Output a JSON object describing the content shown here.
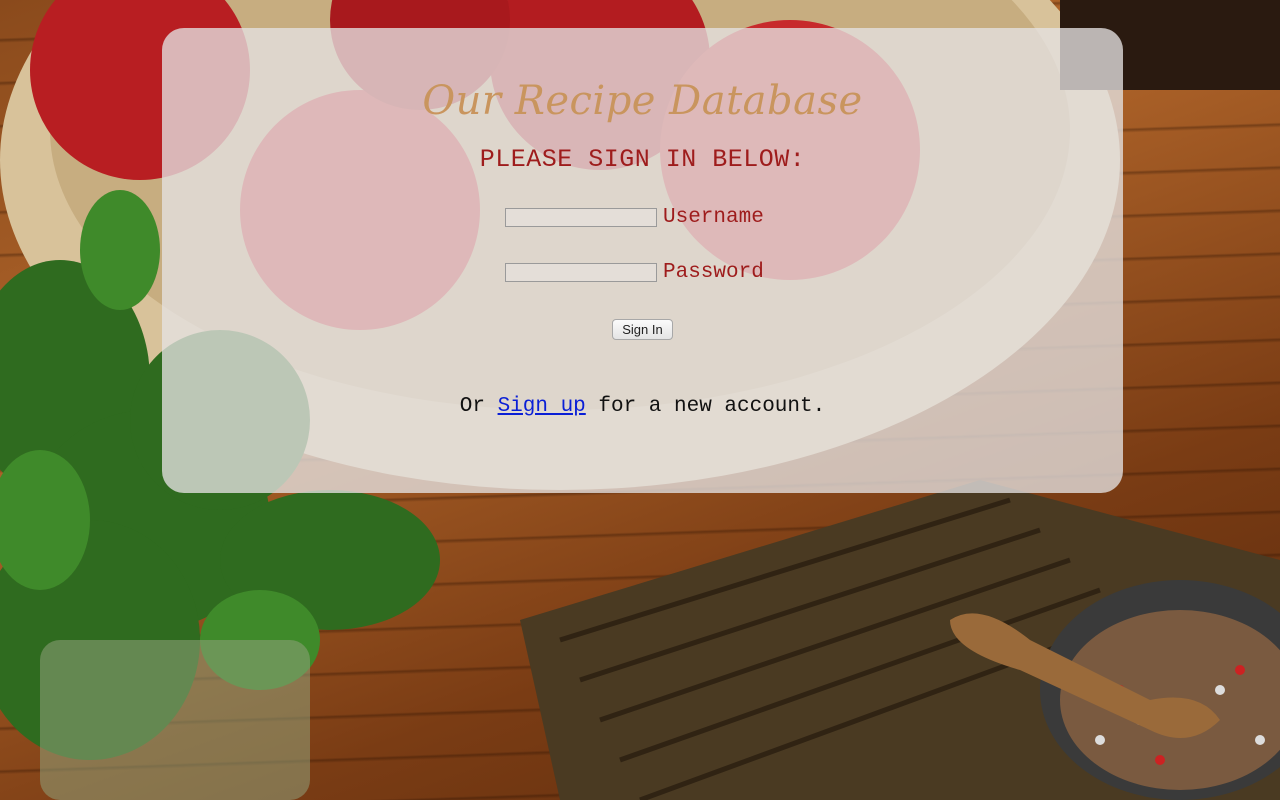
{
  "colors": {
    "brand": "#c9955e",
    "heading": "#9e1c1c",
    "label": "#9e1c1c",
    "link": "#0a1fd6",
    "card_background": "rgba(228,226,226,0.78)"
  },
  "brand": {
    "title": "Our Recipe Database"
  },
  "login": {
    "heading": "PLEASE SIGN IN BELOW:",
    "username": {
      "label": "Username",
      "value": ""
    },
    "password": {
      "label": "Password",
      "value": ""
    },
    "submit_label": "Sign In"
  },
  "signup": {
    "prefix": "Or ",
    "link_text": "Sign up",
    "suffix": " for a new account."
  }
}
